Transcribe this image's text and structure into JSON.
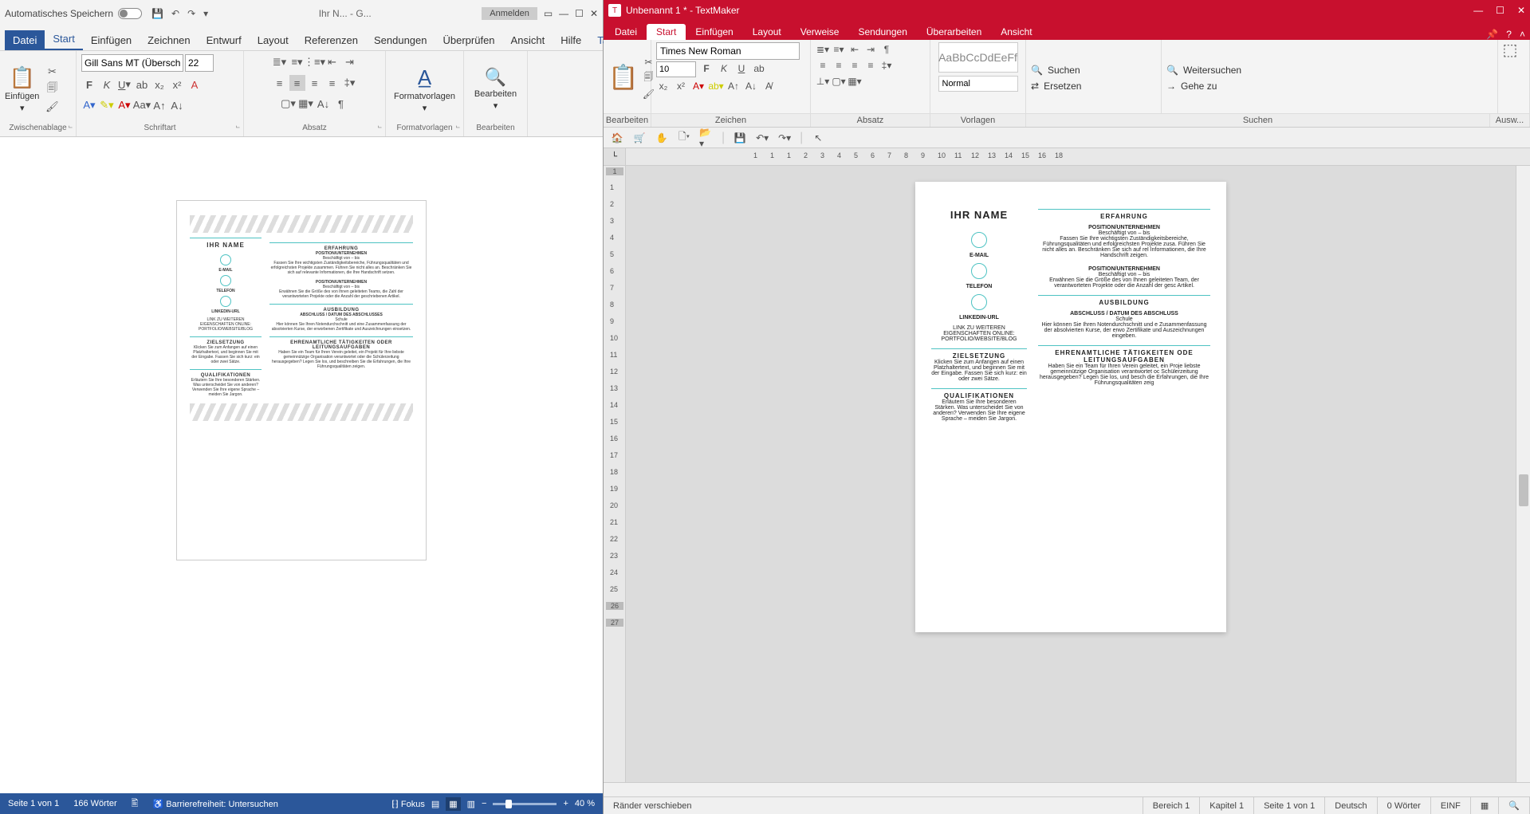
{
  "word": {
    "titlebar": {
      "autosave": "Automatisches Speichern",
      "doc_center": "Ihr N...  - G...",
      "login": "Anmelden"
    },
    "tabs": {
      "file": "Datei",
      "start": "Start",
      "einfuegen": "Einfügen",
      "zeichnen": "Zeichnen",
      "entwurf": "Entwurf",
      "layout": "Layout",
      "referenzen": "Referenzen",
      "sendungen": "Sendungen",
      "ueberpruefen": "Überprüfen",
      "ansicht": "Ansicht",
      "hilfe": "Hilfe",
      "tabellen": "Tabellenentw"
    },
    "ribbon": {
      "clipboard_label": "Zwischenablage",
      "paste": "Einfügen",
      "font_label": "Schriftart",
      "font_name": "Gill Sans MT (Überschri",
      "font_size": "22",
      "para_label": "Absatz",
      "styles_label": "Formatvorlagen",
      "styles_btn": "Formatvorlagen",
      "edit_label": "Bearbeiten",
      "edit_btn": "Bearbeiten"
    },
    "status": {
      "page": "Seite 1 von 1",
      "words": "166 Wörter",
      "access": "Barrierefreiheit: Untersuchen",
      "focus": "Fokus",
      "zoom": "40 %"
    },
    "resume": {
      "name": "IHR NAME",
      "sections": {
        "erfahrung": "ERFAHRUNG",
        "position": "POSITION/UNTERNEHMEN",
        "beschaeftigt": "Beschäftigt von – bis",
        "erf_t1": "Fassen Sie Ihre wichtigsten Zuständigkeitsbereiche, Führungsqualitäten und erfolgreichsten Projekte zusammen. Führen Sie nicht alles an. Beschränken Sie sich auf relevante Informationen, die Ihre Handschrift setzen.",
        "erf_t2": "Erwähnen Sie die Größe des von Ihnen geleiteten Teams, die Zahl der verantworteten Projekte oder die Anzahl der geschriebenen Artikel.",
        "email": "E-MAIL",
        "telefon": "TELEFON",
        "linkedin": "LINKEDIN-URL",
        "link_more": "LINK ZU WEITEREN EIGENSCHAFTEN ONLINE: PORTFOLIO/WEBSITE/BLOG",
        "ziel": "ZIELSETZUNG",
        "ziel_t": "Klicken Sie zum Anfangen auf einen Platzhaltertext, und beginnen Sie mit der Eingabe. Fassen Sie sich kurz: ein oder zwei Sätze.",
        "quali": "QUALIFIKATIONEN",
        "quali_t": "Erläutern Sie Ihre besonderen Stärken. Was unterscheidet Sie von anderen? Verwenden Sie Ihre eigene Sprache – meiden Sie Jargon.",
        "ausbildung": "AUSBILDUNG",
        "abschluss": "ABSCHLUSS / DATUM DES ABSCHLUSSES",
        "schule": "Schule",
        "aus_t": "Hier können Sie Ihren Notendurchschnitt und eine Zusammenfassung der absolvierten Kurse, der erworbenen Zertifikate und Auszeichnungen einsetzen.",
        "ehrenamt": "EHRENAMTLICHE TÄTIGKEITEN ODER LEITUNGSAUFGABEN",
        "ehren_t": "Haben Sie ein Team für Ihren Verein geleitet, ein Projekt für Ihre liebste gemeinnützige Organisation verantwortet oder die Schülerzeitung herausgegeben? Legen Sie los, und beschreiben Sie die Erfahrungen, die Ihre Führungsqualitäten zeigen."
      }
    }
  },
  "tm": {
    "title": "Unbenannt 1 * - TextMaker",
    "tabs": {
      "datei": "Datei",
      "start": "Start",
      "einfuegen": "Einfügen",
      "layout": "Layout",
      "verweise": "Verweise",
      "sendungen": "Sendungen",
      "ueberarbeiten": "Überarbeiten",
      "ansicht": "Ansicht"
    },
    "ribbon": {
      "font_name": "Times New Roman",
      "font_size": "10",
      "style_preview": "AaBbCcDdEeFf",
      "style_name": "Normal",
      "suchen": "Suchen",
      "weitersuchen": "Weitersuchen",
      "ersetzen": "Ersetzen",
      "geheZu": "Gehe zu",
      "labels": {
        "bearbeiten": "Bearbeiten",
        "zeichen": "Zeichen",
        "absatz": "Absatz",
        "vorlagen": "Vorlagen",
        "suchen": "Suchen",
        "ausw": "Ausw..."
      }
    },
    "ruler_h": [
      "1",
      "1",
      "1",
      "2",
      "3",
      "4",
      "5",
      "6",
      "7",
      "8",
      "9",
      "10",
      "11",
      "12",
      "13",
      "14",
      "15",
      "16",
      "18"
    ],
    "ruler_v_top": [
      "1"
    ],
    "ruler_v": [
      "1",
      "2",
      "3",
      "4",
      "5",
      "6",
      "7",
      "8",
      "9",
      "10",
      "11",
      "12",
      "13",
      "14",
      "15",
      "16",
      "17",
      "18",
      "19",
      "20",
      "21",
      "22",
      "23",
      "24",
      "25"
    ],
    "ruler_v_gray": [
      "26",
      "27"
    ],
    "status": {
      "left": "Ränder verschieben",
      "bereich": "Bereich 1",
      "kapitel": "Kapitel 1",
      "seite": "Seite 1 von 1",
      "lang": "Deutsch",
      "words": "0 Wörter",
      "mode": "EINF"
    },
    "resume": {
      "name": "IHR NAME",
      "email": "E-MAIL",
      "telefon": "TELEFON",
      "linkedin": "LINKEDIN-URL",
      "link_more": "LINK ZU WEITEREN EIGENSCHAFTEN ONLINE: PORTFOLIO/WEBSITE/BLOG",
      "ziel": "ZIELSETZUNG",
      "ziel_t": "Klicken Sie zum Anfangen auf einen Platzhaltertext, und beginnen Sie mit der Eingabe. Fassen Sie sich kurz: ein oder zwei Sätze.",
      "quali": "QUALIFIKATIONEN",
      "quali_t": "Erläutern Sie Ihre besonderen Stärken. Was unterscheidet Sie von anderen? Verwenden Sie Ihre eigene Sprache – meiden Sie Jargon.",
      "erfahrung": "ERFAHRUNG",
      "position": "POSITION/UNTERNEHMEN",
      "beschaeftigt": "Beschäftigt von – bis",
      "erf_t1": "Fassen Sie Ihre wichtigsten Zuständigkeitsbereiche, Führungsqualitäten und erfolgreichsten Projekte zusa. Führen Sie nicht alles an. Beschränken Sie sich auf rel Informationen, die Ihre Handschrift zeigen.",
      "erf_t2": "Erwähnen Sie die Größe des von Ihnen geleiteten Team, der verantworteten Projekte oder die Anzahl der gesc Artikel.",
      "ausbildung": "AUSBILDUNG",
      "abschluss": "ABSCHLUSS / DATUM DES ABSCHLUSS",
      "schule": "Schule",
      "aus_t": "Hier können Sie Ihren Notendurchschnitt und e Zusammenfassung der absolvierten Kurse, der erwo Zertifikate und Auszeichnungen eingeben.",
      "ehrenamt": "EHRENAMTLICHE TÄTIGKEITEN ODE LEITUNGSAUFGABEN",
      "ehren_t": "Haben Sie ein Team für Ihren Verein geleitet, ein Proje liebste gemeinnützige Organisation verantwortet oc Schülerzeitung herausgegeben? Legen Sie los, und besch die Erfahrungen, die Ihre Führungsqualitäten zeig"
    }
  }
}
